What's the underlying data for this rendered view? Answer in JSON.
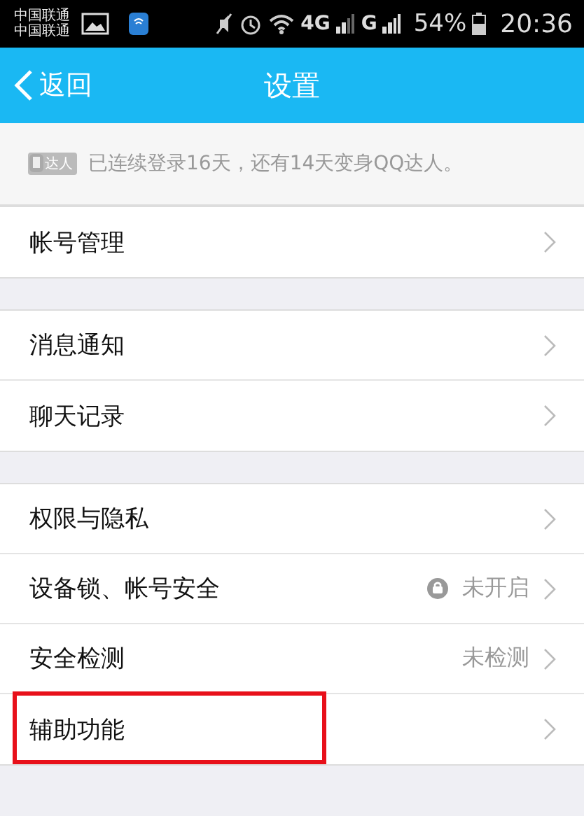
{
  "status_bar": {
    "carriers": [
      "中国联通",
      "中国联通"
    ],
    "network_1": "4G",
    "network_2": "G",
    "battery": "54%",
    "time": "20:36"
  },
  "nav_bar": {
    "back": "返回",
    "title": "设置"
  },
  "banner": {
    "badge": "达人",
    "text": "已连续登录16天，还有14天变身QQ达人。"
  },
  "groups": [
    {
      "items": [
        {
          "label": "帐号管理",
          "highlighted": false
        }
      ]
    },
    {
      "items": [
        {
          "label": "消息通知",
          "highlighted": false
        },
        {
          "label": "聊天记录",
          "highlighted": false
        }
      ]
    },
    {
      "items": [
        {
          "label": "权限与隐私",
          "highlighted": false
        },
        {
          "label": "设备锁、帐号安全",
          "status": "未开启",
          "lock": true,
          "highlighted": false
        },
        {
          "label": "安全检测",
          "status": "未检测",
          "highlighted": false
        },
        {
          "label": "辅助功能",
          "highlighted": true
        }
      ]
    }
  ]
}
